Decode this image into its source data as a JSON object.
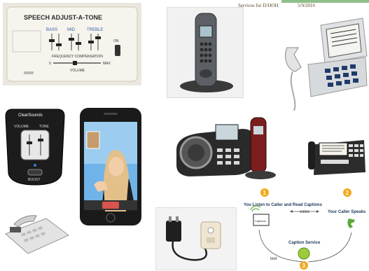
{
  "header": {
    "title": "Services for D/HOH",
    "date": "5/9/2016"
  },
  "amplifier_device": {
    "title": "SPEECH ADJUST-A-TONE",
    "slider_labels": [
      "BASS",
      "MID",
      "TREBLE"
    ],
    "compensation_label": "FREQUENCY COMPENSATION",
    "volume_label": "VOLUME",
    "volume_min": "0",
    "volume_max": "MAX",
    "switch_label": "ON"
  },
  "clearsound_amp": {
    "brand": "ClearSounds",
    "volume_label": "VOLUME",
    "tone_label": "TONE",
    "boost_label": "BOOST"
  },
  "caption_diagram": {
    "step1": "1",
    "step2": "2",
    "step3": "3",
    "you_listen": "You Listen to Caller and Read Captions",
    "voice": "voice",
    "caller_speaks": "Your Caller Speaks",
    "captions_screen": "Captions",
    "caption_service": "Caption Service",
    "text": "text"
  },
  "colors": {
    "step_badge": "#f2a81d",
    "diagram_text": "#1c3a5c",
    "accent_green": "#8fbf8a"
  }
}
